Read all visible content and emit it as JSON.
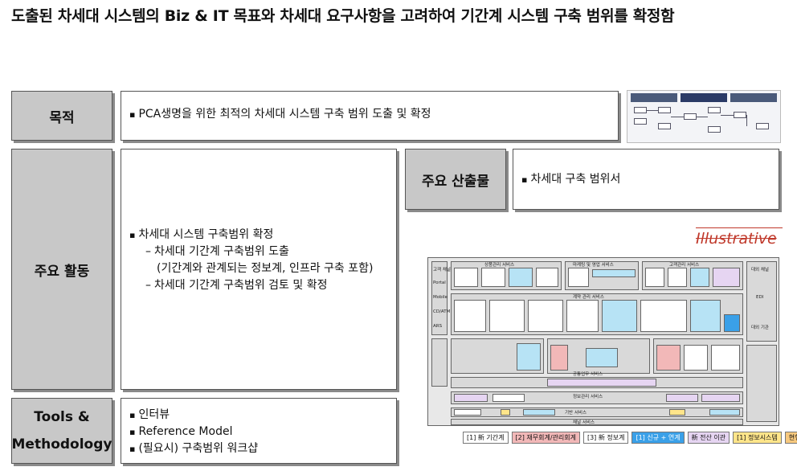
{
  "title": "도출된 차세대 시스템의 Biz & IT 목표와 차세대 요구사항을 고려하여 기간계 시스템 구축 범위를 확정함",
  "sections": {
    "purpose": {
      "label": "목적",
      "bullet": "PCA생명을 위한 최적의 차세대 시스템 구축 범위 도출 및 확정"
    },
    "activities": {
      "label": "주요 활동",
      "bullet": "차세대 시스템 구축범위 확정",
      "sub1": "차세대 기간계 구축범위 도출",
      "sub1_cont": "(기간계와 관계되는 정보계, 인프라 구축 포함)",
      "sub2": "차세대 기간계 구축범위 검토 및 확정"
    },
    "outputs": {
      "label": "주요 산출물",
      "bullet": "차세대 구축 범위서"
    },
    "tools": {
      "label_line1": "Tools &",
      "label_line2": "Methodology",
      "items": [
        "인터뷰",
        "Reference Model",
        "(필요시) 구축범위 워크샵"
      ]
    }
  },
  "illustrative": "Illustrative",
  "diagram": {
    "colors": {
      "light_blue": "#b7e3f5",
      "purple": "#e6d5f2",
      "red": "#f2b8b8",
      "yellow": "#ffe58a",
      "blue": "#3aa0e8"
    },
    "top_headers": [
      "상품관리 서비스",
      "마케팅 및 영업 서비스",
      "고객관리 서비스"
    ],
    "channels": [
      "고객 채널",
      "Portal",
      "Mobile",
      "CD/ATM",
      "ARS"
    ],
    "mid_header": "계약 관리 서비스",
    "bottom_headers": [
      "공통업무 서비스",
      "정보관리 서비스",
      "기반 서비스",
      "채널 서비스"
    ],
    "right_labels": [
      "대외 채널",
      "EDI",
      "대외 기관"
    ],
    "legend": [
      "[1] 新 기간계",
      "[2] 재무회계/관리회계",
      "[3] 新 정보계",
      "[1] 신규 + 연계",
      "新 전산 이관",
      "[1] 정보시스템",
      "현행유지"
    ]
  }
}
